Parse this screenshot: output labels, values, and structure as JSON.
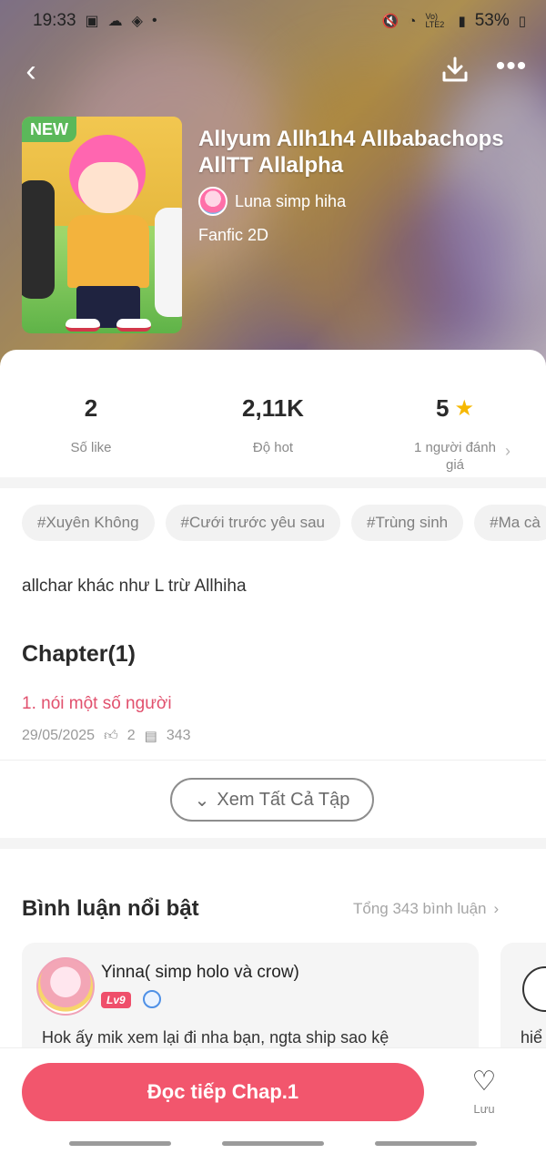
{
  "status_bar": {
    "time": "19:33",
    "left_icons": [
      "photo-icon",
      "weather-icon",
      "app-icon",
      "dot-icon"
    ],
    "right_icons": [
      "mute-icon",
      "wifi-icon",
      "lte-icon",
      "signal-icon"
    ],
    "lte": "Vo) LTE2",
    "battery": "53%"
  },
  "story": {
    "badge": "NEW",
    "title": "Allyum Allh1h4 Allbabachops AllTT Allalpha",
    "author": "Luna simp hiha",
    "genre": "Fanfic 2D"
  },
  "stats": {
    "likes_value": "2",
    "likes_label": "Số like",
    "hot_value": "2,11K",
    "hot_label": "Độ hot",
    "rating_value": "5",
    "rating_label": "1 người đánh giá"
  },
  "tags": [
    "#Xuyên Không",
    "#Cưới trước yêu sau",
    "#Trùng sinh",
    "#Ma cà"
  ],
  "description": "allchar khác như L trừ Allhiha",
  "chapters": {
    "heading": "Chapter(1)",
    "items": [
      {
        "title": "1. nói một số người",
        "date": "29/05/2025",
        "likes": "2",
        "comments": "343"
      }
    ],
    "view_all": "Xem Tất Cả Tập"
  },
  "comments": {
    "heading": "Bình luận nổi bật",
    "total": "Tổng 343 bình luận",
    "items": [
      {
        "user": "Yinna( simp holo và crow)",
        "level": "Lv9",
        "text": "Hok ấy mik xem lại đi nha bạn, ngta ship sao kệ"
      },
      {
        "user": "",
        "level": "",
        "text": "hiể"
      }
    ]
  },
  "bottom": {
    "read_button": "Đọc tiếp Chap.1",
    "save_label": "Lưu"
  },
  "colors": {
    "accent": "#f2566d",
    "chapter_link": "#e1506d",
    "new_badge": "#5bb85a",
    "star": "#f6b800"
  }
}
